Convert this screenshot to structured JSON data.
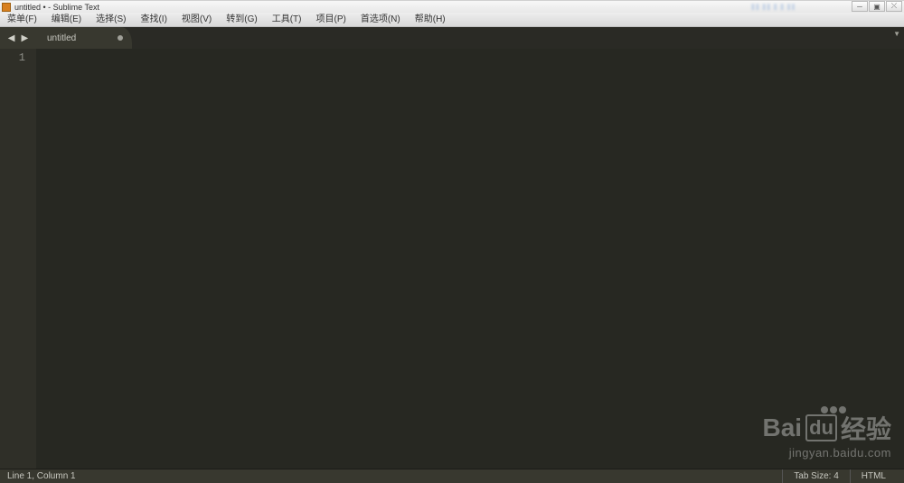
{
  "window": {
    "title": "untitled • - Sublime Text"
  },
  "menubar": {
    "items": [
      "菜单(F)",
      "编辑(E)",
      "选择(S)",
      "查找(I)",
      "视图(V)",
      "转到(G)",
      "工具(T)",
      "项目(P)",
      "首选项(N)",
      "帮助(H)"
    ]
  },
  "tabs": {
    "active": {
      "label": "untitled",
      "dirty": true
    }
  },
  "gutter": {
    "lines": [
      "1"
    ]
  },
  "statusbar": {
    "position": "Line 1, Column 1",
    "tab_size": "Tab Size: 4",
    "syntax": "HTML"
  },
  "watermark": {
    "brand_a": "Bai",
    "brand_b": "du",
    "brand_cn": "经验",
    "url": "jingyan.baidu.com"
  }
}
